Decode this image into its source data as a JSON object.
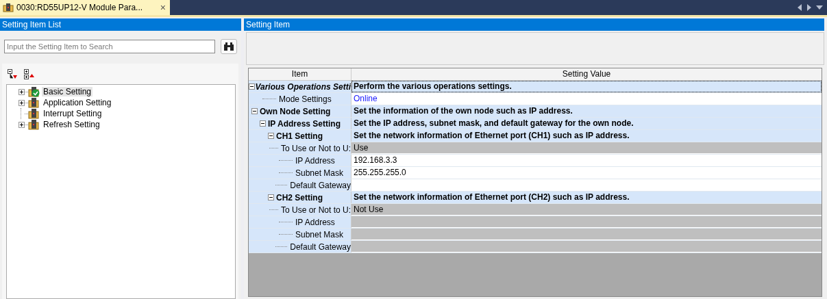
{
  "tab": {
    "title": "0030:RD55UP12-V Module Para...",
    "close": "×"
  },
  "left_panel": {
    "title": "Setting Item List",
    "search": {
      "placeholder": "Input the Setting Item to Search"
    },
    "tree": [
      {
        "label": "Basic Setting",
        "expandable": true,
        "checked": true,
        "selected": true
      },
      {
        "label": "Application Setting",
        "expandable": true,
        "checked": false,
        "selected": false
      },
      {
        "label": "Interrupt Setting",
        "expandable": false,
        "checked": false,
        "selected": false
      },
      {
        "label": "Refresh Setting",
        "expandable": true,
        "checked": false,
        "selected": false
      }
    ]
  },
  "right_panel": {
    "title": "Setting Item",
    "grid": {
      "columns": [
        "Item",
        "Setting Value"
      ],
      "rows": [
        {
          "kind": "group",
          "item": "Various Operations Setti",
          "value": "Perform the various operations settings.",
          "italic": true,
          "expanded": true,
          "selected": true,
          "children": [
            {
              "kind": "field",
              "item": "Mode Settings",
              "value": "Online",
              "link": true,
              "disabled": false,
              "selected": false
            }
          ]
        },
        {
          "kind": "group",
          "item": "Own Node Setting",
          "value": "Set the information of the own node such as IP address.",
          "italic": false,
          "expanded": true,
          "selected": false,
          "children": [
            {
              "kind": "group",
              "item": "IP Address Setting",
              "value": "Set the IP address, subnet mask, and default gateway for the own node.",
              "italic": false,
              "expanded": true,
              "selected": false,
              "children": [
                {
                  "kind": "group",
                  "item": "CH1 Setting",
                  "value": "Set the network information of Ethernet port (CH1) such as IP address.",
                  "italic": false,
                  "expanded": true,
                  "selected": false,
                  "children": [
                    {
                      "kind": "field",
                      "item": "To Use or Not to U:",
                      "value": "Use",
                      "link": false,
                      "disabled": true,
                      "selected": false
                    },
                    {
                      "kind": "field",
                      "item": "IP Address",
                      "value": "192.168.3.3",
                      "link": false,
                      "disabled": false,
                      "selected": false
                    },
                    {
                      "kind": "field",
                      "item": "Subnet Mask",
                      "value": "255.255.255.0",
                      "link": false,
                      "disabled": false,
                      "selected": false
                    },
                    {
                      "kind": "field",
                      "item": "Default Gateway",
                      "link": false,
                      "disabled": false,
                      "selected": false
                    }
                  ]
                },
                {
                  "kind": "group",
                  "item": "CH2 Setting",
                  "value": "Set the network information of Ethernet port (CH2) such as IP address.",
                  "italic": false,
                  "expanded": true,
                  "selected": false,
                  "children": [
                    {
                      "kind": "field",
                      "item": "To Use or Not to U:",
                      "value": "Not Use",
                      "link": false,
                      "disabled": true,
                      "selected": false
                    },
                    {
                      "kind": "field",
                      "item": "IP Address",
                      "link": false,
                      "disabled": true,
                      "selected": false
                    },
                    {
                      "kind": "field",
                      "item": "Subnet Mask",
                      "link": false,
                      "disabled": true,
                      "selected": false
                    },
                    {
                      "kind": "field",
                      "item": "Default Gateway",
                      "link": false,
                      "disabled": true,
                      "selected": false
                    }
                  ]
                }
              ]
            }
          ]
        }
      ]
    }
  }
}
